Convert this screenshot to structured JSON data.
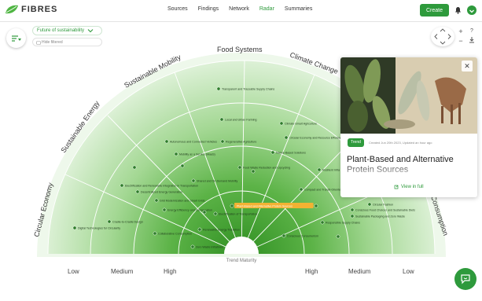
{
  "app": {
    "logo_text": "FIBRES"
  },
  "nav": {
    "items": [
      "Sources",
      "Findings",
      "Network",
      "Radar",
      "Summaries"
    ],
    "active": "Radar"
  },
  "header": {
    "create_label": "Create"
  },
  "radar_controls": {
    "radar_name": "Future of sustainability",
    "hide_shared_label": "Hide filtered"
  },
  "radar": {
    "sectors": [
      "Circular Economy",
      "Sustainable Energy",
      "Sustainable Mobility",
      "Food Systems",
      "Climate Change",
      "Sustainable",
      "Consumption"
    ],
    "center_label": "Trend Maturity",
    "axis_left": [
      "Low",
      "Medium",
      "High"
    ],
    "axis_right": [
      "High",
      "Medium",
      "Low"
    ],
    "items": [
      "Transparent and Traceable Supply Chains",
      "Local and Urban Farming",
      "Climate-Smart Agriculture",
      "Autonomous and Connected Vehicles",
      "Regenerative Agriculture",
      "Circular Economy and Resource Efficiency",
      "Mobility as a Service (MaaS)",
      "Nature-Based Solutions",
      "Food Waste Reduction and Upcycling",
      "Resilient Infra",
      "Shared and On-Demand Mobility",
      "Electrification and Renewable Integration in Transportation",
      "Compact and Transit-Oriented",
      "Decentralized Energy Generation",
      "Grid Modernization and Smart Grids",
      "Plant-Based and Alternative Protein Sources",
      "Circular Fashion",
      "Energy Efficiency and Conservation",
      "Electrification of Transportation",
      "Conscious Food Choices and Sustainable Diets",
      "Sustainable Packaging and Zero Waste",
      "Cradle-to-Cradle Design",
      "Responsible Supply Chains",
      "Digital Technologies for Circularity",
      "Renewable Energy Transition",
      "Collaborative Consumption",
      "Conscious Consumerism",
      "Zero Waste Initiatives"
    ],
    "highlighted": "Plant-Based and Alternative Protein Sources"
  },
  "card": {
    "badge": "Trend",
    "meta": "Created Jun 20th 2023, Updated an hour ago",
    "title": "Plant-Based and Alternative Protein Sources",
    "view_label": "View in full"
  },
  "colors": {
    "accent": "#2e9a3c",
    "highlight": "#f2b233",
    "ring_outer": "#d8efd3",
    "ring_inner": "#3f9e2f"
  }
}
